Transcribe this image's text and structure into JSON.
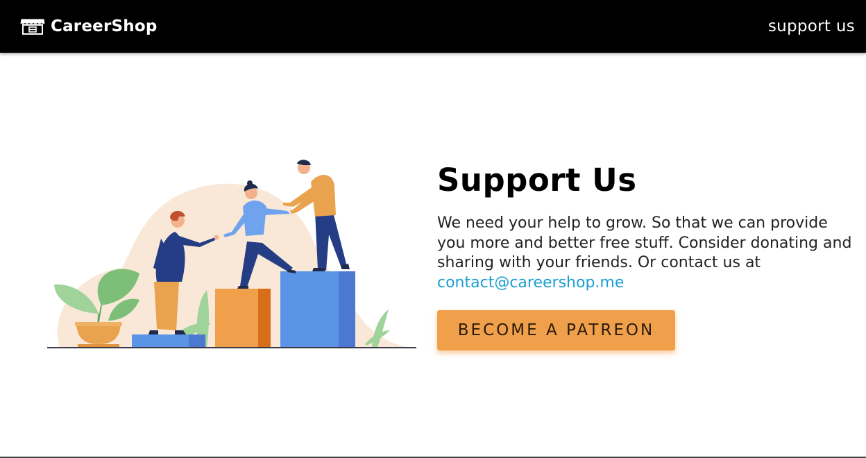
{
  "navbar": {
    "brand_name": "CareerShop",
    "brand_icon": "storefront-icon",
    "support_link": "support us"
  },
  "illustration": {
    "description_icon": "teamwork-illustration"
  },
  "main": {
    "title": "Support Us",
    "description": "We need your help to grow. So that we can provide you more and better free stuff. Consider donating and sharing with your friends. Or contact us at ",
    "email": "contact@careershop.me",
    "cta_label": "BECOME A PATREON"
  },
  "colors": {
    "navbar_bg": "#000000",
    "accent": "#f0a04b",
    "link": "#1a9fd0"
  }
}
